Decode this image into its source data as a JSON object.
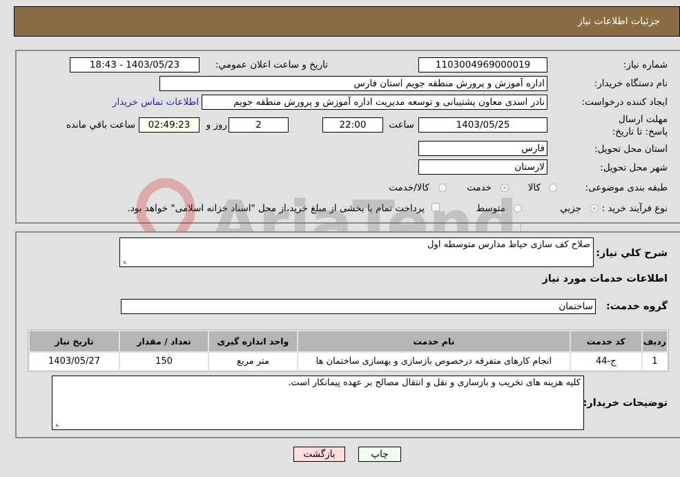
{
  "header": {
    "title": "جزئیات اطلاعات نیاز"
  },
  "details": {
    "need_number": {
      "label": "شماره نیاز:",
      "value": "1103004969000019"
    },
    "announce_datetime": {
      "label": "تاریخ و ساعت اعلان عمومي:",
      "value": "1403/05/23 - 18:43"
    },
    "buyer_org": {
      "label": "نام دستگاه خریدار:",
      "value": "اداره آموزش و پرورش منطقه جویم استان فارس"
    },
    "requester": {
      "label": "ایجاد کننده درخواست:",
      "value": "نادر اسدی معاون پشتیبانی و توسعه مدیریت اداره آموزش و پرورش منطقه جویم",
      "contact_link": "اطلاعات تماس خریدار"
    },
    "deadline": {
      "label": "مهلت ارسال پاسخ: تا تاریخ:",
      "date": "1403/05/25",
      "time_label": "ساعت",
      "time": "22:00",
      "days": "2",
      "days_label": "روز و",
      "remaining": "02:49:23",
      "remaining_label": "ساعت باقي مانده"
    },
    "province": {
      "label": "استان محل تحویل:",
      "value": "فارس"
    },
    "city": {
      "label": "شهر محل تحویل:",
      "value": "لارستان"
    },
    "category": {
      "label": "طبقه بندی موضوعی:",
      "options": [
        "کالا",
        "خدمت",
        "کالا/خدمت"
      ],
      "selected": "خدمت"
    },
    "purchase_type": {
      "label": "نوع فرآیند خرید :",
      "options": [
        "جزيي",
        "متوسط"
      ],
      "selected": "جزيي",
      "treasury_note": "پرداخت تمام یا بخشی از مبلغ خرید،از محل \"اسناد خزانه اسلامی\" خواهد بود."
    }
  },
  "description": {
    "label": "شرح كلي نياز:",
    "value": "صلاح کف سازی حیاط مدارس متوسطه اول"
  },
  "services_section": {
    "title": "اطلاعات خدمات مورد نياز"
  },
  "service_group": {
    "label": "گروه خدمت:",
    "value": "ساختمان"
  },
  "table": {
    "headers": [
      "ردیف",
      "کد خدمت",
      "نام خدمت",
      "واحد اندازه گیری",
      "تعداد / مقدار",
      "تاریخ نیاز"
    ],
    "rows": [
      [
        "1",
        "ج-44",
        "انجام کارهای متفرقه درخصوص بازسازی و بهسازی ساختمان ها",
        "متر مربع",
        "150",
        "1403/05/27"
      ]
    ]
  },
  "buyer_notes": {
    "label": "توضیحات خریدار:",
    "value": "کلیه هزینه های تخریب و بازسازی و نقل و انتقال مصالح بر عهده پیمانکار است."
  },
  "buttons": {
    "print": "چاپ",
    "back": "بازگشت"
  },
  "colors": {
    "header_bg": "#8b6d43",
    "print_bg": "#eeffee",
    "back_bg": "#ffdddd",
    "link": "#2222cc"
  },
  "watermark": {
    "text": "AriaTender.neT"
  }
}
